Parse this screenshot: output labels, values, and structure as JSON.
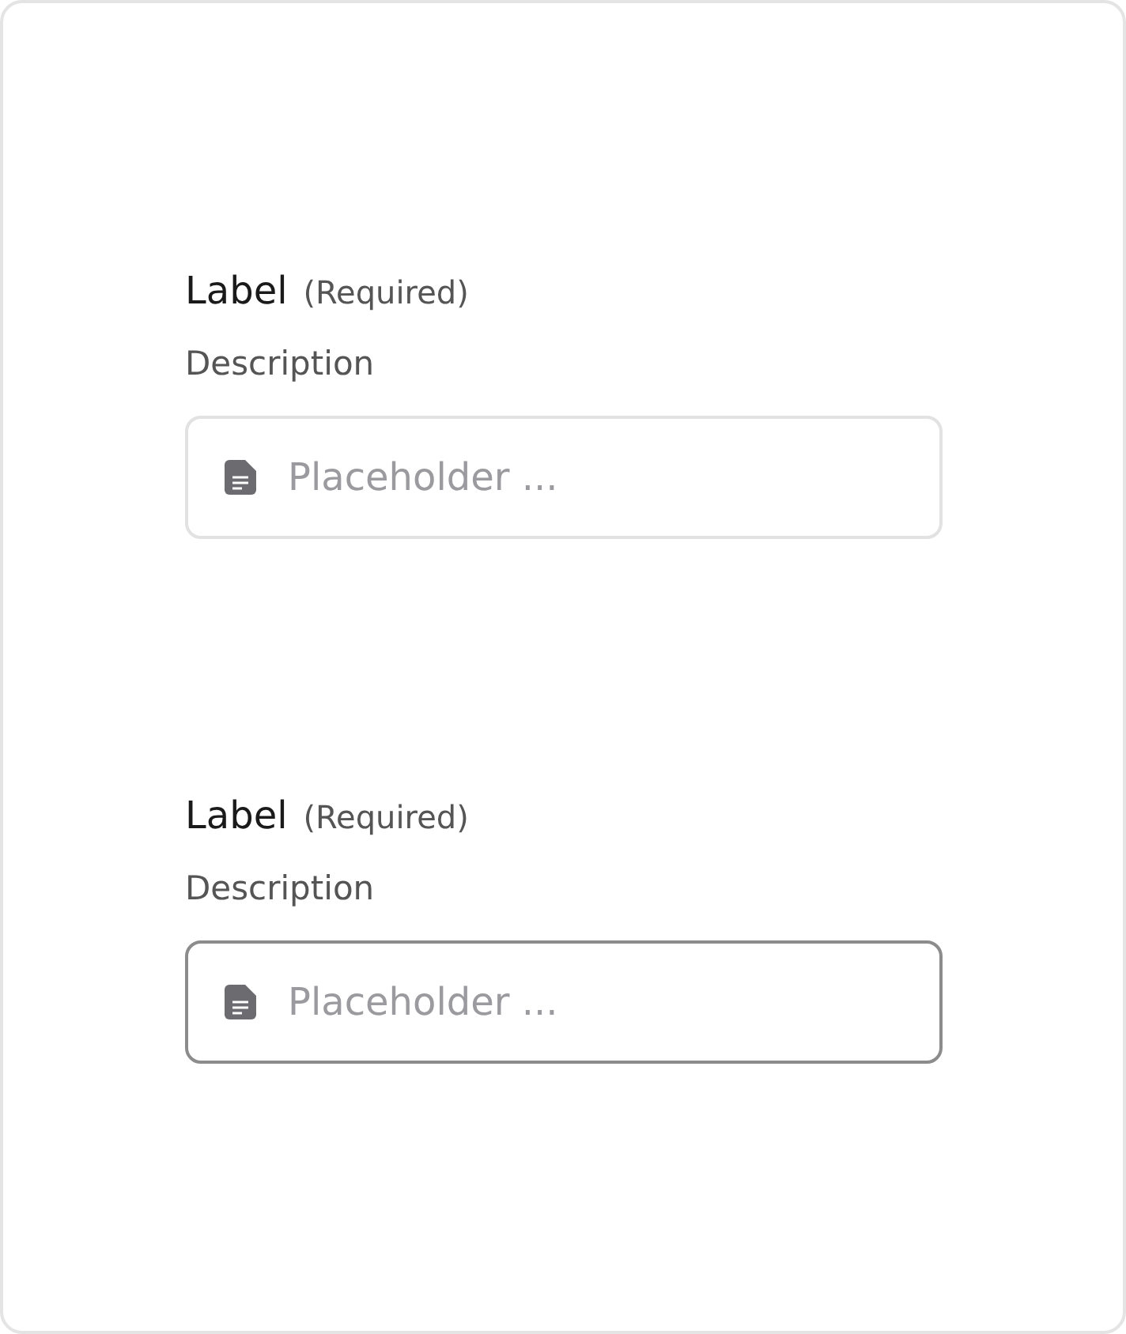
{
  "fields": [
    {
      "label": "Label",
      "required_note": "(Required)",
      "description": "Description",
      "placeholder": "Placeholder ...",
      "hovered": false
    },
    {
      "label": "Label",
      "required_note": "(Required)",
      "description": "Description",
      "placeholder": "Placeholder ...",
      "hovered": true
    }
  ]
}
